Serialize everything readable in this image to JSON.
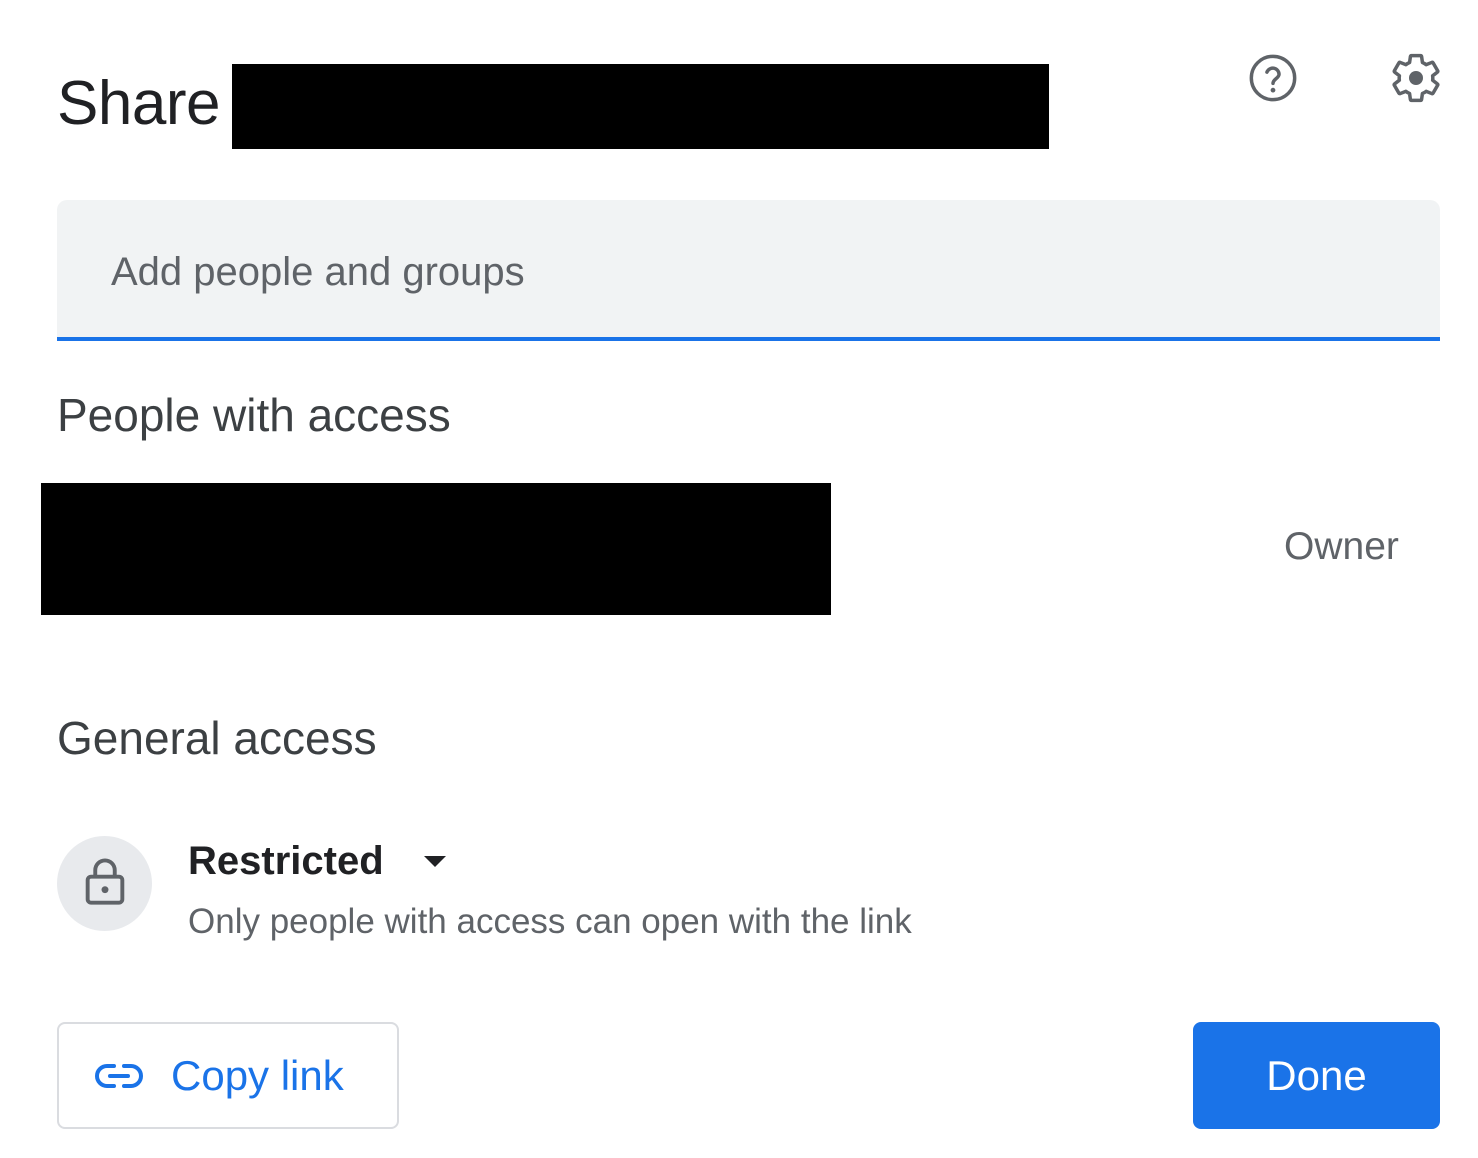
{
  "dialog": {
    "title": "Share",
    "help_icon": "help-circle-icon",
    "settings_icon": "gear-icon"
  },
  "add_people": {
    "placeholder": "Add people and groups",
    "value": ""
  },
  "people_with_access": {
    "heading": "People with access",
    "people": [
      {
        "role": "Owner"
      }
    ]
  },
  "general_access": {
    "heading": "General access",
    "icon": "lock-icon",
    "selected": "Restricted",
    "description": "Only people with access can open with the link"
  },
  "footer": {
    "copy_link_label": "Copy link",
    "copy_link_icon": "link-icon",
    "done_label": "Done"
  },
  "colors": {
    "accent": "#1a73e8",
    "field_background": "#f1f3f4",
    "text_primary": "#202124",
    "text_secondary": "#5f6368"
  }
}
